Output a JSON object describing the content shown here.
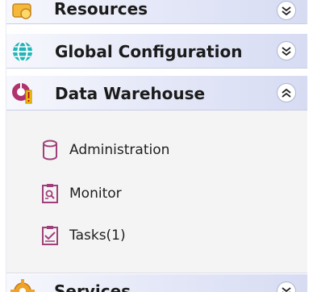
{
  "sections": {
    "resources": {
      "title": "Resources",
      "state": "collapsed",
      "icon": "resources-icon"
    },
    "global_configuration": {
      "title": "Global Configuration",
      "state": "collapsed",
      "icon": "globe-icon"
    },
    "data_warehouse": {
      "title": "Data Warehouse",
      "state": "expanded",
      "icon": "data-warehouse-warning-icon",
      "items": [
        {
          "label": "Administration",
          "icon": "database-icon"
        },
        {
          "label": "Monitor",
          "icon": "monitor-clipboard-icon"
        },
        {
          "label": "Tasks(1)",
          "icon": "tasks-clipboard-icon"
        }
      ]
    },
    "services": {
      "title": "Services",
      "state": "collapsed",
      "icon": "gear-icon"
    }
  },
  "colors": {
    "header_gradient_start": "#f7f8fd",
    "header_gradient_end": "#d7dcf3",
    "item_icon": "#a0407a",
    "globe": "#1aa3a8",
    "warning": "#f4c20d",
    "gear": "#e89a1a",
    "content_bg": "#f4f4f4"
  }
}
